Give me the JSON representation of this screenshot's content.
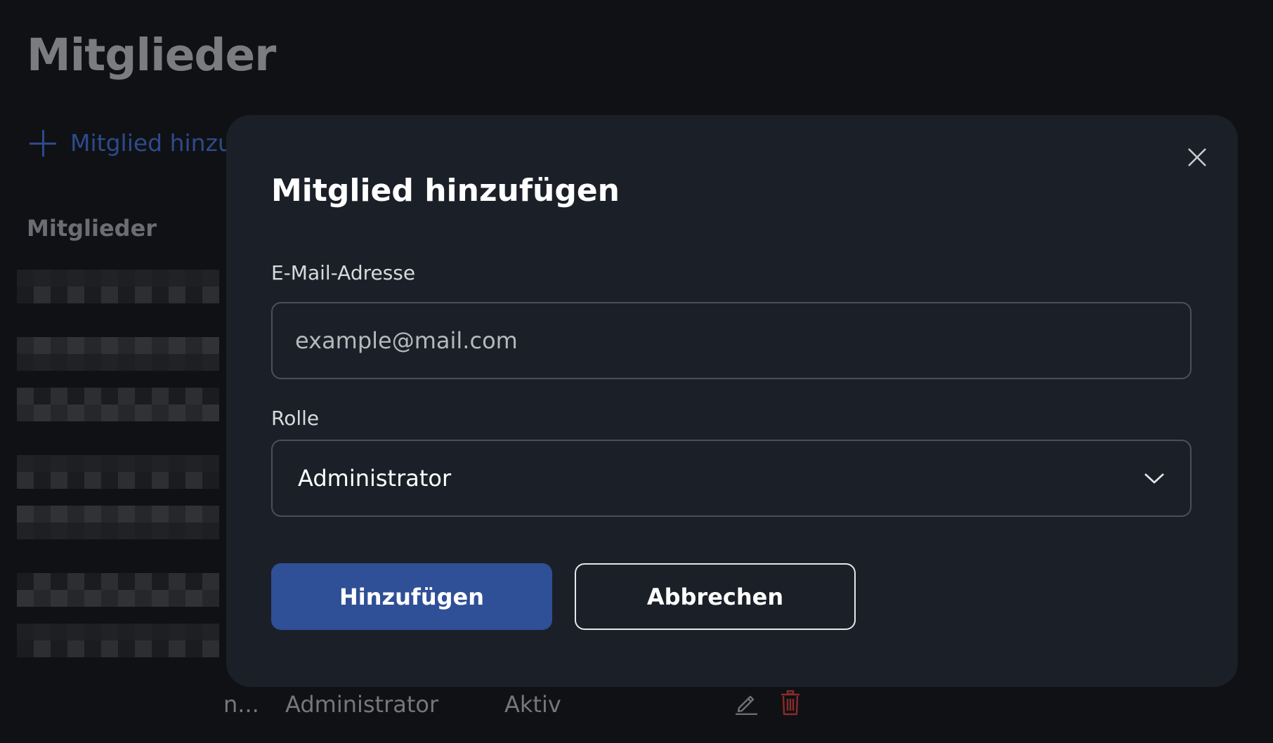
{
  "page": {
    "title": "Mitglieder",
    "add_link_label": "Mitglied hinzuf",
    "section_label": "Mitglieder"
  },
  "table_peek": {
    "name_suffix": "n...",
    "role": "Administrator",
    "status": "Aktiv"
  },
  "modal": {
    "title": "Mitglied hinzufügen",
    "email_label": "E-Mail-Adresse",
    "email_value": "",
    "email_placeholder": "example@mail.com",
    "role_label": "Rolle",
    "role_value": "Administrator",
    "submit_label": "Hinzufügen",
    "cancel_label": "Abbrechen"
  },
  "colors": {
    "background": "#0f1115",
    "modal": "#1b2028",
    "primary": "#2f4f97",
    "link": "#2d4a8a",
    "danger": "#9b2c2c"
  }
}
